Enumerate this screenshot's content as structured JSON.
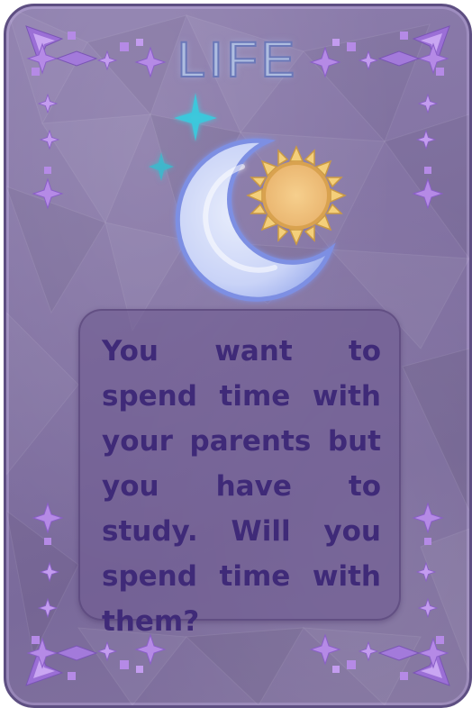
{
  "card": {
    "category": "LIFE",
    "question": "You want to spend time with your parents but you have to study. Will you spend time with them?",
    "emblem": {
      "icons": [
        "crescent-moon-icon",
        "sun-icon",
        "sparkle-star-icon"
      ]
    },
    "decorations": [
      "corner-star-ornament",
      "side-diamond-ornament"
    ]
  },
  "colors": {
    "card_background": "#8373a3",
    "card_border": "#5e4f82",
    "title": "#aebde0",
    "question_text": "#3f2a78",
    "panel": "#705c91",
    "moon": "#c9d3f7",
    "sun": "#f0c080",
    "sparkle": "#3cc8dc",
    "ornament": "#b58ae6"
  }
}
